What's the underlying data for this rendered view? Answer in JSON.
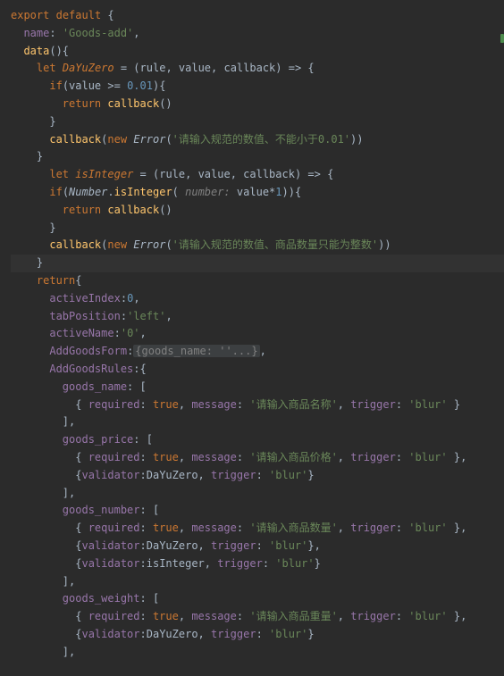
{
  "lines": [
    {
      "indent": 0,
      "tokens": [
        [
          "kw",
          "export"
        ],
        [
          "pun",
          " "
        ],
        [
          "kw",
          "default"
        ],
        [
          "pun",
          " {"
        ]
      ]
    },
    {
      "indent": 1,
      "tokens": [
        [
          "prop",
          "name"
        ],
        [
          "pun",
          ": "
        ],
        [
          "str",
          "'Goods-add'"
        ],
        [
          "pun",
          ","
        ]
      ]
    },
    {
      "indent": 1,
      "tokens": [
        [
          "fn",
          "data"
        ],
        [
          "pun",
          "(){"
        ]
      ]
    },
    {
      "indent": 2,
      "tokens": [
        [
          "kw",
          "let"
        ],
        [
          "pun",
          " "
        ],
        [
          "decl",
          "DaYuZero"
        ],
        [
          "pun",
          " = ("
        ],
        [
          "pun",
          "rule"
        ],
        [
          "pun",
          ", "
        ],
        [
          "pun",
          "value"
        ],
        [
          "pun",
          ", "
        ],
        [
          "pun",
          "callback"
        ],
        [
          "pun",
          ") => {"
        ]
      ]
    },
    {
      "indent": 3,
      "tokens": [
        [
          "kw",
          "if"
        ],
        [
          "pun",
          "(value >= "
        ],
        [
          "num",
          "0.01"
        ],
        [
          "pun",
          "){"
        ]
      ]
    },
    {
      "indent": 4,
      "tokens": [
        [
          "kw",
          "return"
        ],
        [
          "pun",
          " "
        ],
        [
          "fn",
          "callback"
        ],
        [
          "pun",
          "()"
        ]
      ]
    },
    {
      "indent": 3,
      "tokens": [
        [
          "pun",
          "}"
        ]
      ]
    },
    {
      "indent": 3,
      "tokens": [
        [
          "fn",
          "callback"
        ],
        [
          "pun",
          "("
        ],
        [
          "kw",
          "new"
        ],
        [
          "pun",
          " "
        ],
        [
          "cls",
          "Error"
        ],
        [
          "pun",
          "("
        ],
        [
          "str",
          "'请输入规范的数值、不能小于0.01'"
        ],
        [
          "pun",
          "))"
        ]
      ]
    },
    {
      "indent": 2,
      "tokens": [
        [
          "pun",
          "}"
        ]
      ]
    },
    {
      "indent": 3,
      "tokens": [
        [
          "kw",
          "let"
        ],
        [
          "pun",
          " "
        ],
        [
          "decl",
          "isInteger"
        ],
        [
          "pun",
          " = ("
        ],
        [
          "pun",
          "rule"
        ],
        [
          "pun",
          ", "
        ],
        [
          "pun",
          "value"
        ],
        [
          "pun",
          ", "
        ],
        [
          "pun",
          "callback"
        ],
        [
          "pun",
          ") => {"
        ]
      ]
    },
    {
      "indent": 3,
      "tokens": [
        [
          "kw",
          "if"
        ],
        [
          "pun",
          "("
        ],
        [
          "cls",
          "Number"
        ],
        [
          "pun",
          "."
        ],
        [
          "fn",
          "isInteger"
        ],
        [
          "pun",
          "( "
        ],
        [
          "param",
          "number: "
        ],
        [
          "pun",
          "value*"
        ],
        [
          "num",
          "1"
        ],
        [
          "pun",
          ")){"
        ]
      ]
    },
    {
      "indent": 4,
      "tokens": [
        [
          "kw",
          "return"
        ],
        [
          "pun",
          " "
        ],
        [
          "fn",
          "callback"
        ],
        [
          "pun",
          "()"
        ]
      ]
    },
    {
      "indent": 3,
      "tokens": [
        [
          "pun",
          "}"
        ]
      ]
    },
    {
      "indent": 3,
      "tokens": [
        [
          "fn",
          "callback"
        ],
        [
          "pun",
          "("
        ],
        [
          "kw",
          "new"
        ],
        [
          "pun",
          " "
        ],
        [
          "cls",
          "Error"
        ],
        [
          "pun",
          "("
        ],
        [
          "str",
          "'请输入规范的数值、商品数量只能为整数'"
        ],
        [
          "pun",
          "))"
        ]
      ]
    },
    {
      "indent": 2,
      "tokens": [
        [
          "pun",
          "}"
        ]
      ],
      "hl": true
    },
    {
      "indent": 2,
      "tokens": [
        [
          "kw",
          "return"
        ],
        [
          "pun",
          "{"
        ]
      ]
    },
    {
      "indent": 3,
      "tokens": [
        [
          "prop",
          "activeIndex"
        ],
        [
          "pun",
          ":"
        ],
        [
          "num",
          "0"
        ],
        [
          "pun",
          ","
        ]
      ]
    },
    {
      "indent": 3,
      "tokens": [
        [
          "prop",
          "tabPosition"
        ],
        [
          "pun",
          ":"
        ],
        [
          "str",
          "'left'"
        ],
        [
          "pun",
          ","
        ]
      ]
    },
    {
      "indent": 3,
      "tokens": [
        [
          "prop",
          "activeName"
        ],
        [
          "pun",
          ":"
        ],
        [
          "str",
          "'0'"
        ],
        [
          "pun",
          ","
        ]
      ]
    },
    {
      "indent": 3,
      "tokens": [
        [
          "prop",
          "AddGoodsForm"
        ],
        [
          "pun",
          ":"
        ],
        [
          "folded",
          "{goods_name: ''...}"
        ],
        [
          "pun",
          ","
        ]
      ]
    },
    {
      "indent": 3,
      "tokens": [
        [
          "prop",
          "AddGoodsRules"
        ],
        [
          "pun",
          ":{"
        ]
      ]
    },
    {
      "indent": 4,
      "tokens": [
        [
          "prop",
          "goods_name"
        ],
        [
          "pun",
          ": ["
        ]
      ]
    },
    {
      "indent": 5,
      "tokens": [
        [
          "pun",
          "{ "
        ],
        [
          "prop",
          "required"
        ],
        [
          "pun",
          ": "
        ],
        [
          "bool",
          "true"
        ],
        [
          "pun",
          ", "
        ],
        [
          "prop",
          "message"
        ],
        [
          "pun",
          ": "
        ],
        [
          "str",
          "'请输入商品名称'"
        ],
        [
          "pun",
          ", "
        ],
        [
          "prop",
          "trigger"
        ],
        [
          "pun",
          ": "
        ],
        [
          "str",
          "'blur'"
        ],
        [
          "pun",
          " }"
        ]
      ]
    },
    {
      "indent": 4,
      "tokens": [
        [
          "pun",
          "],"
        ]
      ]
    },
    {
      "indent": 4,
      "tokens": [
        [
          "prop",
          "goods_price"
        ],
        [
          "pun",
          ": ["
        ]
      ]
    },
    {
      "indent": 5,
      "tokens": [
        [
          "pun",
          "{ "
        ],
        [
          "prop",
          "required"
        ],
        [
          "pun",
          ": "
        ],
        [
          "bool",
          "true"
        ],
        [
          "pun",
          ", "
        ],
        [
          "prop",
          "message"
        ],
        [
          "pun",
          ": "
        ],
        [
          "str",
          "'请输入商品价格'"
        ],
        [
          "pun",
          ", "
        ],
        [
          "prop",
          "trigger"
        ],
        [
          "pun",
          ": "
        ],
        [
          "str",
          "'blur'"
        ],
        [
          "pun",
          " },"
        ]
      ]
    },
    {
      "indent": 5,
      "tokens": [
        [
          "pun",
          "{"
        ],
        [
          "prop",
          "validator"
        ],
        [
          "pun",
          ":"
        ],
        [
          "pun",
          "DaYuZero"
        ],
        [
          "pun",
          ", "
        ],
        [
          "prop",
          "trigger"
        ],
        [
          "pun",
          ": "
        ],
        [
          "str",
          "'blur'"
        ],
        [
          "pun",
          "}"
        ]
      ]
    },
    {
      "indent": 4,
      "tokens": [
        [
          "pun",
          "],"
        ]
      ]
    },
    {
      "indent": 4,
      "tokens": [
        [
          "prop",
          "goods_number"
        ],
        [
          "pun",
          ": ["
        ]
      ]
    },
    {
      "indent": 5,
      "tokens": [
        [
          "pun",
          "{ "
        ],
        [
          "prop",
          "required"
        ],
        [
          "pun",
          ": "
        ],
        [
          "bool",
          "true"
        ],
        [
          "pun",
          ", "
        ],
        [
          "prop",
          "message"
        ],
        [
          "pun",
          ": "
        ],
        [
          "str",
          "'请输入商品数量'"
        ],
        [
          "pun",
          ", "
        ],
        [
          "prop",
          "trigger"
        ],
        [
          "pun",
          ": "
        ],
        [
          "str",
          "'blur'"
        ],
        [
          "pun",
          " },"
        ]
      ]
    },
    {
      "indent": 5,
      "tokens": [
        [
          "pun",
          "{"
        ],
        [
          "prop",
          "validator"
        ],
        [
          "pun",
          ":"
        ],
        [
          "pun",
          "DaYuZero"
        ],
        [
          "pun",
          ", "
        ],
        [
          "prop",
          "trigger"
        ],
        [
          "pun",
          ": "
        ],
        [
          "str",
          "'blur'"
        ],
        [
          "pun",
          "},"
        ]
      ]
    },
    {
      "indent": 5,
      "tokens": [
        [
          "pun",
          "{"
        ],
        [
          "prop",
          "validator"
        ],
        [
          "pun",
          ":"
        ],
        [
          "pun",
          "isInteger"
        ],
        [
          "pun",
          ", "
        ],
        [
          "prop",
          "trigger"
        ],
        [
          "pun",
          ": "
        ],
        [
          "str",
          "'blur'"
        ],
        [
          "pun",
          "}"
        ]
      ]
    },
    {
      "indent": 4,
      "tokens": [
        [
          "pun",
          "],"
        ]
      ]
    },
    {
      "indent": 4,
      "tokens": [
        [
          "prop",
          "goods_weight"
        ],
        [
          "pun",
          ": ["
        ]
      ]
    },
    {
      "indent": 5,
      "tokens": [
        [
          "pun",
          "{ "
        ],
        [
          "prop",
          "required"
        ],
        [
          "pun",
          ": "
        ],
        [
          "bool",
          "true"
        ],
        [
          "pun",
          ", "
        ],
        [
          "prop",
          "message"
        ],
        [
          "pun",
          ": "
        ],
        [
          "str",
          "'请输入商品重量'"
        ],
        [
          "pun",
          ", "
        ],
        [
          "prop",
          "trigger"
        ],
        [
          "pun",
          ": "
        ],
        [
          "str",
          "'blur'"
        ],
        [
          "pun",
          " },"
        ]
      ]
    },
    {
      "indent": 5,
      "tokens": [
        [
          "pun",
          "{"
        ],
        [
          "prop",
          "validator"
        ],
        [
          "pun",
          ":"
        ],
        [
          "pun",
          "DaYuZero"
        ],
        [
          "pun",
          ", "
        ],
        [
          "prop",
          "trigger"
        ],
        [
          "pun",
          ": "
        ],
        [
          "str",
          "'blur'"
        ],
        [
          "pun",
          "}"
        ]
      ]
    },
    {
      "indent": 4,
      "tokens": [
        [
          "pun",
          "],"
        ]
      ]
    }
  ],
  "indent_unit": "  "
}
